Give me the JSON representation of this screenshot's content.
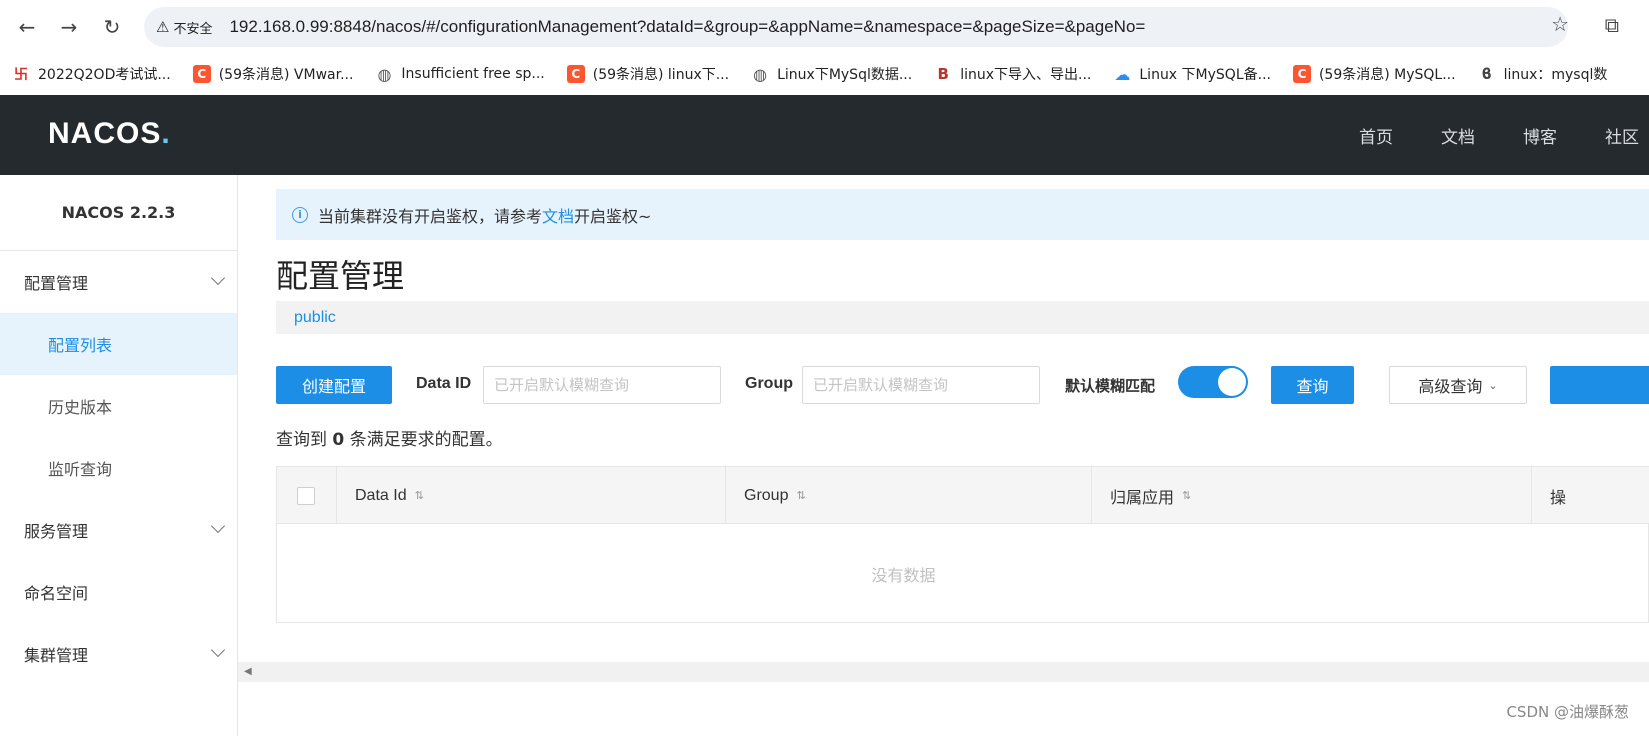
{
  "browser": {
    "insecure_label": "不安全",
    "url": "192.168.0.99:8848/nacos/#/configurationManagement?dataId=&group=&appName=&namespace=&pageSize=&pageNo=",
    "bookmarks": [
      {
        "label": "2022Q2OD考试试...",
        "color": "#d93025",
        "glyph": "卐"
      },
      {
        "label": "(59条消息) VMwar...",
        "color": "#fc5531",
        "glyph": "C"
      },
      {
        "label": "Insufficient free sp...",
        "color": "#555555",
        "glyph": "◍"
      },
      {
        "label": "(59条消息) linux下...",
        "color": "#fc5531",
        "glyph": "C"
      },
      {
        "label": "Linux下MySql数据...",
        "color": "#555555",
        "glyph": "◍"
      },
      {
        "label": "linux下导入、导出...",
        "color": "#b8352d",
        "glyph": "B"
      },
      {
        "label": "Linux 下MySQL备...",
        "color": "#2d8cf0",
        "glyph": "☁"
      },
      {
        "label": "(59条消息) MySQL...",
        "color": "#fc5531",
        "glyph": "C"
      },
      {
        "label": "linux：mysql数",
        "color": "#444444",
        "glyph": "ϐ"
      }
    ]
  },
  "header": {
    "logo": "NACOS",
    "nav": [
      "首页",
      "文档",
      "博客",
      "社区"
    ]
  },
  "sidebar": {
    "version": "NACOS 2.2.3",
    "items": [
      {
        "label": "配置管理"
      },
      {
        "label": "配置列表"
      },
      {
        "label": "历史版本"
      },
      {
        "label": "监听查询"
      },
      {
        "label": "服务管理"
      },
      {
        "label": "命名空间"
      },
      {
        "label": "集群管理"
      }
    ]
  },
  "main": {
    "notice_before": "当前集群没有开启鉴权，请参考",
    "notice_link": "文档",
    "notice_after": "开启鉴权~",
    "title": "配置管理",
    "namespace": "public",
    "create_button": "创建配置",
    "data_id_label": "Data ID",
    "data_id_placeholder": "已开启默认模糊查询",
    "group_label": "Group",
    "group_placeholder": "已开启默认模糊查询",
    "fuzzy_label": "默认模糊匹配",
    "query_button": "查询",
    "advanced_button": "高级查询",
    "result_prefix": "查询到 ",
    "result_count": "0",
    "result_suffix": " 条满足要求的配置。",
    "columns": [
      "Data Id",
      "Group",
      "归属应用",
      "操"
    ],
    "empty_text": "没有数据"
  },
  "watermark": "CSDN @油爆酥葱"
}
